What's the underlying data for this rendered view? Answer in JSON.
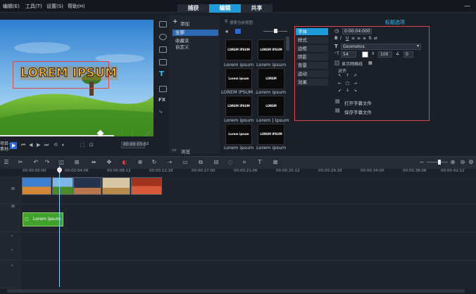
{
  "menu": [
    {
      "label": "编辑(E)"
    },
    {
      "label": "工具(T)"
    },
    {
      "label": "设置(S)"
    },
    {
      "label": "帮助(H)"
    }
  ],
  "main_tabs": [
    {
      "label": "捕获",
      "active": false
    },
    {
      "label": "编辑",
      "active": true
    },
    {
      "label": "共享",
      "active": false
    }
  ],
  "window_controls": {
    "minimize": "—"
  },
  "preview": {
    "overlay_text": "LOREM IPSUM",
    "project_label": "项目-",
    "clip_label": "素材-",
    "timecode": "00:00:03:0"
  },
  "library": {
    "add_label": "添加",
    "folders": [
      {
        "label": "全部",
        "selected": true
      },
      {
        "label": "收藏夹",
        "selected": false
      },
      {
        "label": "自定义",
        "selected": false
      }
    ],
    "search_placeholder": "搜索当前视图",
    "browse_label": "浏览",
    "thumbs": [
      {
        "thumb_text": "LOREM IPSUM",
        "caption": "Lorem ipsum"
      },
      {
        "thumb_text": "LOREM IPSUM",
        "caption": "Lorem ipsum"
      },
      {
        "thumb_text": "Lorem ipsum",
        "caption": "LOREM IPSUM ..."
      },
      {
        "thumb_text": "LOREM",
        "caption": "Lorem ipsum"
      },
      {
        "thumb_text": "LOREM IPSUM",
        "caption": "Lorem ipsum"
      },
      {
        "thumb_text": "LOREM",
        "caption": "Lorem | Ipsum"
      },
      {
        "thumb_text": "Lorem ipsum",
        "caption": "Lorem ipsum"
      },
      {
        "thumb_text": "LOREM IPSUM",
        "caption": "Lorem ipsum"
      }
    ]
  },
  "options": {
    "panel_title": "标题选项",
    "tabs": [
      {
        "label": "字体",
        "active": true
      },
      {
        "label": "样式",
        "active": false
      },
      {
        "label": "边框",
        "active": false
      },
      {
        "label": "阴影",
        "active": false
      },
      {
        "label": "背景",
        "active": false
      },
      {
        "label": "运动",
        "active": false
      },
      {
        "label": "效果",
        "active": false
      }
    ],
    "duration": "0:00:04:000",
    "font_name": "Geometos",
    "font_size": "54",
    "line_spacing": "100",
    "rotation": "0",
    "show_grid_label": "显示网格线",
    "align_label": "对齐",
    "open_subtitle": "打开字幕文件",
    "save_subtitle": "保存字幕文件"
  },
  "timeline": {
    "ruler_labels": [
      "00:00:00:00",
      "00:00:04:06",
      "00:00:08:12",
      "00:00:12:18",
      "00:00:17:00",
      "00:00:21:06",
      "00:00:25:12",
      "00:00:29:18",
      "00:00:34:00",
      "00:00:38:06",
      "00:00:42:12"
    ],
    "title_clip_label": "Lorem ipsum"
  }
}
